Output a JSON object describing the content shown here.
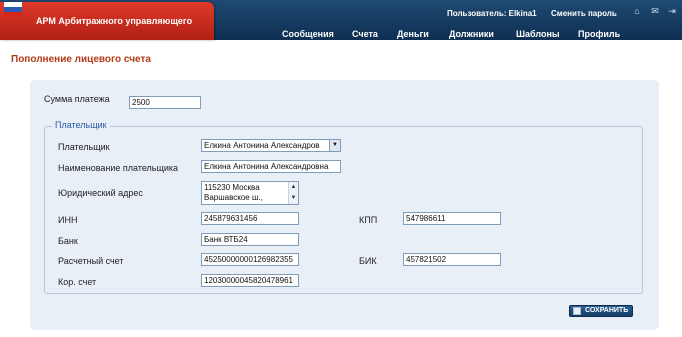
{
  "app": {
    "title": "АРМ Арбитражного управляющего"
  },
  "header": {
    "user_label": "Пользователь: Elkina1",
    "change_password": "Сменить пароль",
    "icons": [
      "home-icon",
      "mail-icon",
      "exit-icon"
    ]
  },
  "menu": [
    "Сообщения",
    "Счета",
    "Деньги",
    "Должники",
    "Шаблоны",
    "Профиль"
  ],
  "page": {
    "title": "Пополнение лицевого счета"
  },
  "form": {
    "amount": {
      "label": "Сумма платежа",
      "value": "2500"
    },
    "legend": "Плательщик",
    "payer": {
      "label": "Плательщик",
      "value": "Елкина Антонина Александров"
    },
    "payer_name": {
      "label": "Наименование плательщика",
      "value": "Елкина Антонина Александровна"
    },
    "address": {
      "label": "Юридический адрес",
      "line1": "115230 Москва",
      "line2": "Варшавское ш.,"
    },
    "inn": {
      "label": "ИНН",
      "value": "245879631456"
    },
    "kpp": {
      "label": "КПП",
      "value": "547986611"
    },
    "bank": {
      "label": "Банк",
      "value": "Банк ВТБ24"
    },
    "account": {
      "label": "Расчетный счет",
      "value": "45250000000126982355"
    },
    "bik": {
      "label": "БИК",
      "value": "457821502"
    },
    "corr_account": {
      "label": "Кор. счет",
      "value": "12030000045820478961"
    },
    "save_label": "СОХРАНИТЬ"
  },
  "colors": {
    "header": "#1a4269",
    "brand": "#cc2f22",
    "page_title": "#b33a16",
    "panel": "#e9eff7",
    "legend": "#2a58a8"
  }
}
